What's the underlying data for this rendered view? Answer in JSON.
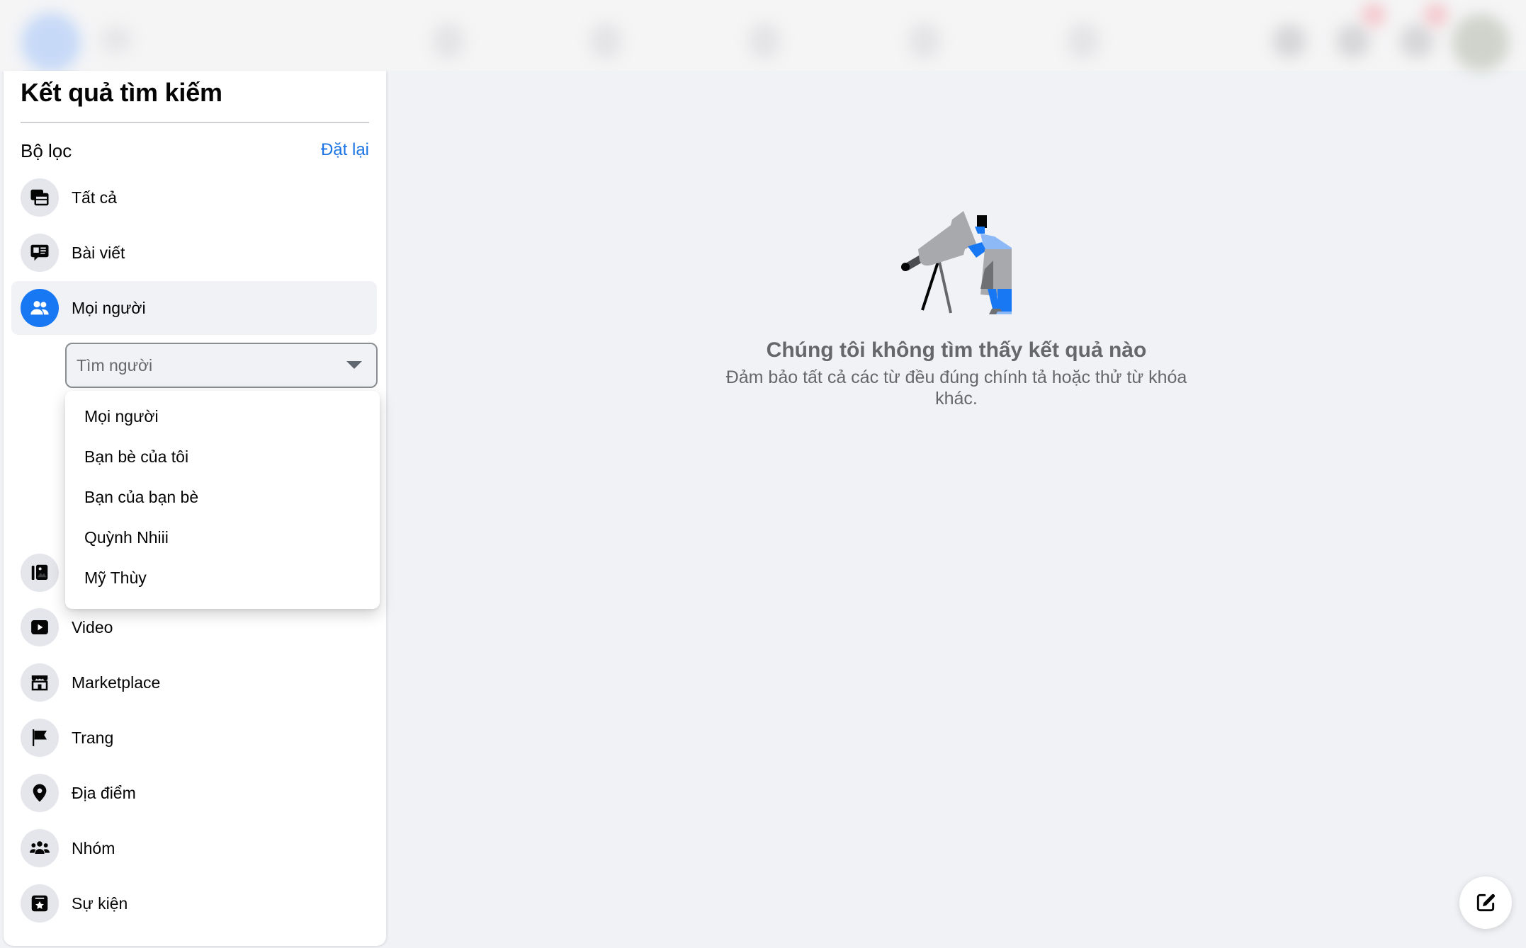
{
  "navbar": {
    "state": "blurred",
    "icons": [
      "facebook-logo-icon",
      "search-icon",
      "home-icon",
      "watch-icon",
      "marketplace-icon",
      "groups-icon",
      "gaming-icon",
      "menu-icon",
      "messenger-icon",
      "notifications-icon",
      "avatar"
    ]
  },
  "sidebar": {
    "title": "Kết quả tìm kiếm",
    "filter_label": "Bộ lọc",
    "reset_label": "Đặt lại",
    "items": [
      {
        "label": "Tất cả",
        "icon": "all-results-icon",
        "selected": false
      },
      {
        "label": "Bài viết",
        "icon": "posts-icon",
        "selected": false
      },
      {
        "label": "Mọi người",
        "icon": "people-icon",
        "selected": true
      },
      {
        "label": "Ảnh",
        "icon": "photos-icon",
        "selected": false
      },
      {
        "label": "Video",
        "icon": "video-icon",
        "selected": false
      },
      {
        "label": "Marketplace",
        "icon": "marketplace-icon",
        "selected": false
      },
      {
        "label": "Trang",
        "icon": "flag-icon",
        "selected": false
      },
      {
        "label": "Địa điểm",
        "icon": "location-pin-icon",
        "selected": false
      },
      {
        "label": "Nhóm",
        "icon": "groups-icon",
        "selected": false
      },
      {
        "label": "Sự kiện",
        "icon": "event-star-icon",
        "selected": false
      }
    ],
    "people_filter": {
      "input_value": "",
      "placeholder": "Tìm người",
      "options": [
        "Mọi người",
        "Bạn bè của tôi",
        "Bạn của bạn bè",
        "Quỳnh Nhiii",
        "Mỹ Thùy"
      ]
    }
  },
  "main": {
    "empty_title": "Chúng tôi không tìm thấy kết quả nào",
    "empty_subtitle": "Đảm bảo tất cả các từ đều đúng chính tả hoặc thử từ khóa khác."
  },
  "colors": {
    "accent": "#1877f2",
    "link": "#1b74e4",
    "background": "#f0f2f5",
    "muted_text": "#65676b"
  }
}
